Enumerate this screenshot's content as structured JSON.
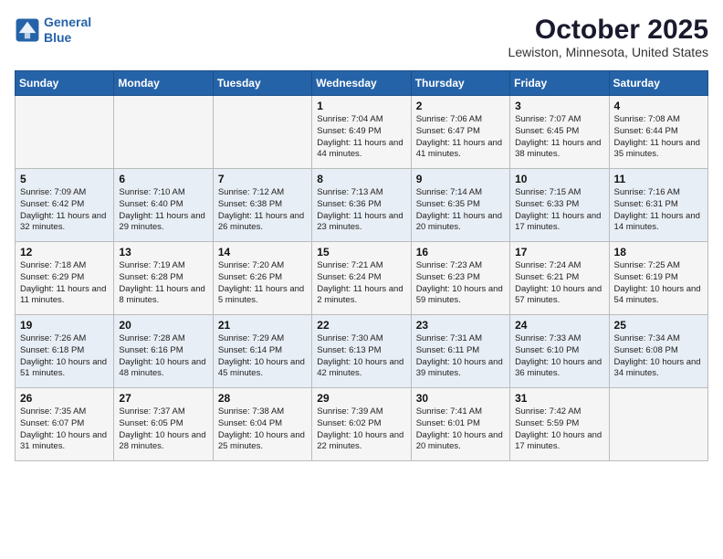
{
  "logo": {
    "line1": "General",
    "line2": "Blue"
  },
  "title": "October 2025",
  "location": "Lewiston, Minnesota, United States",
  "weekdays": [
    "Sunday",
    "Monday",
    "Tuesday",
    "Wednesday",
    "Thursday",
    "Friday",
    "Saturday"
  ],
  "weeks": [
    [
      {
        "day": "",
        "sunrise": "",
        "sunset": "",
        "daylight": ""
      },
      {
        "day": "",
        "sunrise": "",
        "sunset": "",
        "daylight": ""
      },
      {
        "day": "",
        "sunrise": "",
        "sunset": "",
        "daylight": ""
      },
      {
        "day": "1",
        "sunrise": "Sunrise: 7:04 AM",
        "sunset": "Sunset: 6:49 PM",
        "daylight": "Daylight: 11 hours and 44 minutes."
      },
      {
        "day": "2",
        "sunrise": "Sunrise: 7:06 AM",
        "sunset": "Sunset: 6:47 PM",
        "daylight": "Daylight: 11 hours and 41 minutes."
      },
      {
        "day": "3",
        "sunrise": "Sunrise: 7:07 AM",
        "sunset": "Sunset: 6:45 PM",
        "daylight": "Daylight: 11 hours and 38 minutes."
      },
      {
        "day": "4",
        "sunrise": "Sunrise: 7:08 AM",
        "sunset": "Sunset: 6:44 PM",
        "daylight": "Daylight: 11 hours and 35 minutes."
      }
    ],
    [
      {
        "day": "5",
        "sunrise": "Sunrise: 7:09 AM",
        "sunset": "Sunset: 6:42 PM",
        "daylight": "Daylight: 11 hours and 32 minutes."
      },
      {
        "day": "6",
        "sunrise": "Sunrise: 7:10 AM",
        "sunset": "Sunset: 6:40 PM",
        "daylight": "Daylight: 11 hours and 29 minutes."
      },
      {
        "day": "7",
        "sunrise": "Sunrise: 7:12 AM",
        "sunset": "Sunset: 6:38 PM",
        "daylight": "Daylight: 11 hours and 26 minutes."
      },
      {
        "day": "8",
        "sunrise": "Sunrise: 7:13 AM",
        "sunset": "Sunset: 6:36 PM",
        "daylight": "Daylight: 11 hours and 23 minutes."
      },
      {
        "day": "9",
        "sunrise": "Sunrise: 7:14 AM",
        "sunset": "Sunset: 6:35 PM",
        "daylight": "Daylight: 11 hours and 20 minutes."
      },
      {
        "day": "10",
        "sunrise": "Sunrise: 7:15 AM",
        "sunset": "Sunset: 6:33 PM",
        "daylight": "Daylight: 11 hours and 17 minutes."
      },
      {
        "day": "11",
        "sunrise": "Sunrise: 7:16 AM",
        "sunset": "Sunset: 6:31 PM",
        "daylight": "Daylight: 11 hours and 14 minutes."
      }
    ],
    [
      {
        "day": "12",
        "sunrise": "Sunrise: 7:18 AM",
        "sunset": "Sunset: 6:29 PM",
        "daylight": "Daylight: 11 hours and 11 minutes."
      },
      {
        "day": "13",
        "sunrise": "Sunrise: 7:19 AM",
        "sunset": "Sunset: 6:28 PM",
        "daylight": "Daylight: 11 hours and 8 minutes."
      },
      {
        "day": "14",
        "sunrise": "Sunrise: 7:20 AM",
        "sunset": "Sunset: 6:26 PM",
        "daylight": "Daylight: 11 hours and 5 minutes."
      },
      {
        "day": "15",
        "sunrise": "Sunrise: 7:21 AM",
        "sunset": "Sunset: 6:24 PM",
        "daylight": "Daylight: 11 hours and 2 minutes."
      },
      {
        "day": "16",
        "sunrise": "Sunrise: 7:23 AM",
        "sunset": "Sunset: 6:23 PM",
        "daylight": "Daylight: 10 hours and 59 minutes."
      },
      {
        "day": "17",
        "sunrise": "Sunrise: 7:24 AM",
        "sunset": "Sunset: 6:21 PM",
        "daylight": "Daylight: 10 hours and 57 minutes."
      },
      {
        "day": "18",
        "sunrise": "Sunrise: 7:25 AM",
        "sunset": "Sunset: 6:19 PM",
        "daylight": "Daylight: 10 hours and 54 minutes."
      }
    ],
    [
      {
        "day": "19",
        "sunrise": "Sunrise: 7:26 AM",
        "sunset": "Sunset: 6:18 PM",
        "daylight": "Daylight: 10 hours and 51 minutes."
      },
      {
        "day": "20",
        "sunrise": "Sunrise: 7:28 AM",
        "sunset": "Sunset: 6:16 PM",
        "daylight": "Daylight: 10 hours and 48 minutes."
      },
      {
        "day": "21",
        "sunrise": "Sunrise: 7:29 AM",
        "sunset": "Sunset: 6:14 PM",
        "daylight": "Daylight: 10 hours and 45 minutes."
      },
      {
        "day": "22",
        "sunrise": "Sunrise: 7:30 AM",
        "sunset": "Sunset: 6:13 PM",
        "daylight": "Daylight: 10 hours and 42 minutes."
      },
      {
        "day": "23",
        "sunrise": "Sunrise: 7:31 AM",
        "sunset": "Sunset: 6:11 PM",
        "daylight": "Daylight: 10 hours and 39 minutes."
      },
      {
        "day": "24",
        "sunrise": "Sunrise: 7:33 AM",
        "sunset": "Sunset: 6:10 PM",
        "daylight": "Daylight: 10 hours and 36 minutes."
      },
      {
        "day": "25",
        "sunrise": "Sunrise: 7:34 AM",
        "sunset": "Sunset: 6:08 PM",
        "daylight": "Daylight: 10 hours and 34 minutes."
      }
    ],
    [
      {
        "day": "26",
        "sunrise": "Sunrise: 7:35 AM",
        "sunset": "Sunset: 6:07 PM",
        "daylight": "Daylight: 10 hours and 31 minutes."
      },
      {
        "day": "27",
        "sunrise": "Sunrise: 7:37 AM",
        "sunset": "Sunset: 6:05 PM",
        "daylight": "Daylight: 10 hours and 28 minutes."
      },
      {
        "day": "28",
        "sunrise": "Sunrise: 7:38 AM",
        "sunset": "Sunset: 6:04 PM",
        "daylight": "Daylight: 10 hours and 25 minutes."
      },
      {
        "day": "29",
        "sunrise": "Sunrise: 7:39 AM",
        "sunset": "Sunset: 6:02 PM",
        "daylight": "Daylight: 10 hours and 22 minutes."
      },
      {
        "day": "30",
        "sunrise": "Sunrise: 7:41 AM",
        "sunset": "Sunset: 6:01 PM",
        "daylight": "Daylight: 10 hours and 20 minutes."
      },
      {
        "day": "31",
        "sunrise": "Sunrise: 7:42 AM",
        "sunset": "Sunset: 5:59 PM",
        "daylight": "Daylight: 10 hours and 17 minutes."
      },
      {
        "day": "",
        "sunrise": "",
        "sunset": "",
        "daylight": ""
      }
    ]
  ]
}
